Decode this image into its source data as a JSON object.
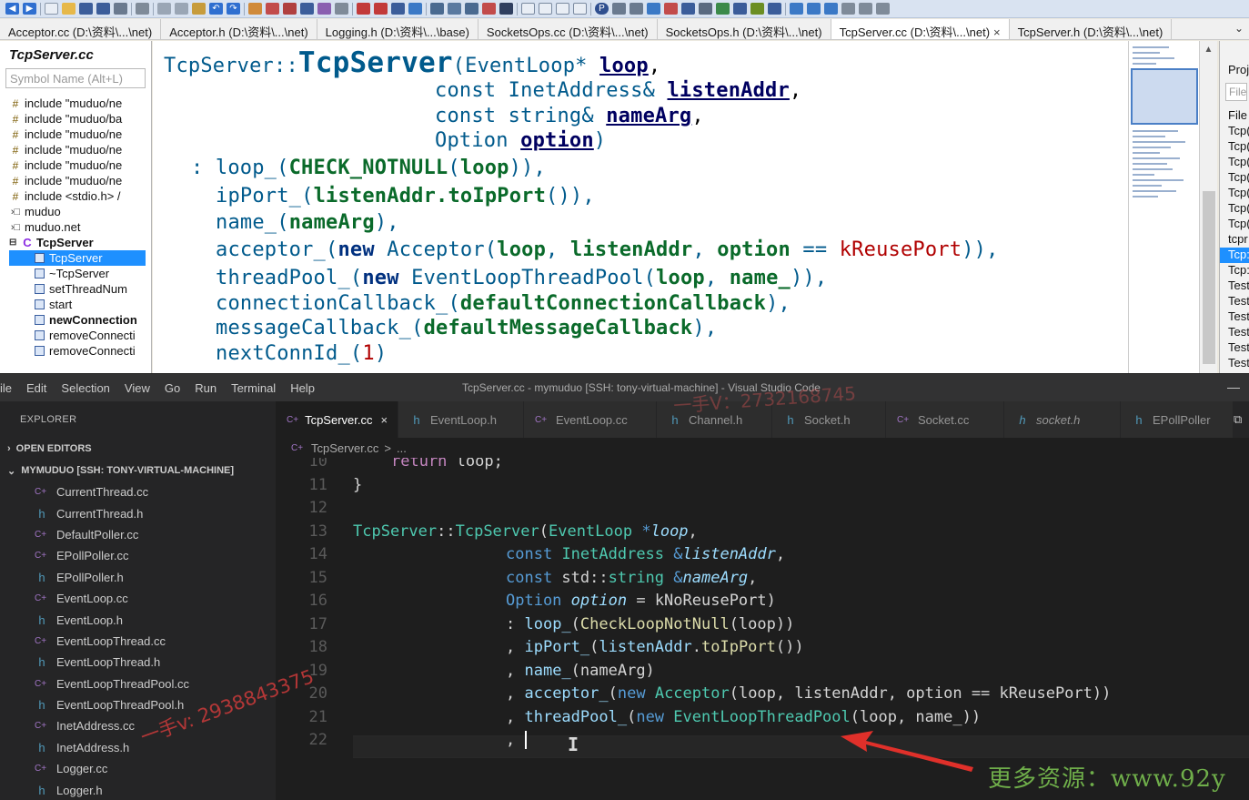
{
  "si": {
    "tabs": [
      {
        "label": "Acceptor.cc (D:\\资料\\...\\net)"
      },
      {
        "label": "Acceptor.h (D:\\资料\\...\\net)"
      },
      {
        "label": "Logging.h (D:\\资料\\...\\base)"
      },
      {
        "label": "SocketsOps.cc (D:\\资料\\...\\net)"
      },
      {
        "label": "SocketsOps.h (D:\\资料\\...\\net)"
      },
      {
        "label": "TcpServer.cc (D:\\资料\\...\\net)",
        "close": "×"
      },
      {
        "label": "TcpServer.h (D:\\资料\\...\\net)"
      }
    ],
    "tabs_more": "⌄",
    "symbol_panel": {
      "title": "TcpServer.cc",
      "search_placeholder": "Symbol Name (Alt+L)",
      "items": [
        {
          "label": "include \"muduo/ne",
          "icon": "include-icon"
        },
        {
          "label": "include \"muduo/ba",
          "icon": "include-icon"
        },
        {
          "label": "include \"muduo/ne",
          "icon": "include-icon"
        },
        {
          "label": "include \"muduo/ne",
          "icon": "include-icon"
        },
        {
          "label": "include \"muduo/ne",
          "icon": "include-icon"
        },
        {
          "label": "include \"muduo/ne",
          "icon": "include-icon"
        },
        {
          "label": "include <stdio.h> /",
          "icon": "include-icon"
        },
        {
          "label": "muduo",
          "icon": "namespace-icon"
        },
        {
          "label": "muduo.net",
          "icon": "namespace-icon"
        },
        {
          "label": "TcpServer",
          "icon": "class-icon"
        },
        {
          "label": "TcpServer",
          "icon": "function-icon"
        },
        {
          "label": "~TcpServer",
          "icon": "function-icon"
        },
        {
          "label": "setThreadNum",
          "icon": "function-icon"
        },
        {
          "label": "start",
          "icon": "function-icon"
        },
        {
          "label": "newConnection",
          "icon": "function-icon"
        },
        {
          "label": "removeConnecti",
          "icon": "function-icon"
        },
        {
          "label": "removeConnecti",
          "icon": "function-icon"
        }
      ]
    },
    "code": {
      "l1": {
        "a": "TcpServer::",
        "b": "TcpServer",
        "c": "(",
        "d": "EventLoop*",
        "e": " ",
        "f": "loop",
        "g": ","
      },
      "l2": {
        "a": "const InetAddress& ",
        "b": "listenAddr",
        "c": ","
      },
      "l3": {
        "a": "const string& ",
        "b": "nameArg",
        "c": ","
      },
      "l4": {
        "a": "Option ",
        "b": "option",
        "c": ")"
      },
      "l5": {
        "a": ": ",
        "b": "loop_",
        "c": "(",
        "d": "CHECK_NOTNULL",
        "e": "(",
        "f": "loop",
        "g": ")),"
      },
      "l6": {
        "a": "ipPort_",
        "b": "(",
        "c": "listenAddr",
        "d": ".",
        "e": "toIpPort",
        "f": "()),"
      },
      "l7": {
        "a": "name_",
        "b": "(",
        "c": "nameArg",
        "d": "),"
      },
      "l8": {
        "a": "acceptor_",
        "b": "(",
        "c": "new",
        "d": " Acceptor(",
        "e": "loop",
        "f": ", ",
        "g": "listenAddr",
        "h": ", ",
        "i": "option",
        "j": " == ",
        "k": "kReusePort",
        "l": ")),"
      },
      "l9": {
        "a": "threadPool_",
        "b": "(",
        "c": "new",
        "d": " EventLoopThreadPool(",
        "e": "loop",
        "f": ", ",
        "g": "name_",
        "h": ")),"
      },
      "l10": {
        "a": "connectionCallback_",
        "b": "(",
        "c": "defaultConnectionCallback",
        "d": "),"
      },
      "l11": {
        "a": "messageCallback_",
        "b": "(",
        "c": "defaultMessageCallback",
        "d": "),"
      },
      "l12": {
        "a": "nextConnId_",
        "b": "(",
        "c": "1",
        "d": ")"
      }
    },
    "project_panel": {
      "title": "Proj",
      "search": "File",
      "header": "File",
      "items": [
        "Tcp(",
        "Tcp(",
        "Tcp(",
        "Tcp(",
        "Tcp(",
        "Tcp(",
        "Tcp(",
        "tcpr",
        "Tcp:",
        "Tcp:",
        "Test",
        "Test",
        "Test",
        "Test",
        "Test",
        "Test"
      ]
    }
  },
  "vscode": {
    "menu": [
      "ile",
      "Edit",
      "Selection",
      "View",
      "Go",
      "Run",
      "Terminal",
      "Help"
    ],
    "title": "TcpServer.cc - mymuduo [SSH: tony-virtual-machine] - Visual Studio Code",
    "window_control": "—",
    "explorer": {
      "title": "EXPLORER",
      "open_editors": "OPEN EDITORS",
      "workspace": "MYMUDUO [SSH: TONY-VIRTUAL-MACHINE]",
      "files": [
        {
          "name": "CurrentThread.cc",
          "kind": "cpp"
        },
        {
          "name": "CurrentThread.h",
          "kind": "h"
        },
        {
          "name": "DefaultPoller.cc",
          "kind": "cpp"
        },
        {
          "name": "EPollPoller.cc",
          "kind": "cpp"
        },
        {
          "name": "EPollPoller.h",
          "kind": "h"
        },
        {
          "name": "EventLoop.cc",
          "kind": "cpp"
        },
        {
          "name": "EventLoop.h",
          "kind": "h"
        },
        {
          "name": "EventLoopThread.cc",
          "kind": "cpp"
        },
        {
          "name": "EventLoopThread.h",
          "kind": "h"
        },
        {
          "name": "EventLoopThreadPool.cc",
          "kind": "cpp"
        },
        {
          "name": "EventLoopThreadPool.h",
          "kind": "h"
        },
        {
          "name": "InetAddress.cc",
          "kind": "cpp"
        },
        {
          "name": "InetAddress.h",
          "kind": "h"
        },
        {
          "name": "Logger.cc",
          "kind": "cpp"
        },
        {
          "name": "Logger.h",
          "kind": "h"
        }
      ]
    },
    "tabs": [
      {
        "label": "TcpServer.cc",
        "kind": "cpp",
        "close": "×"
      },
      {
        "label": "EventLoop.h",
        "kind": "h"
      },
      {
        "label": "EventLoop.cc",
        "kind": "cpp"
      },
      {
        "label": "Channel.h",
        "kind": "h"
      },
      {
        "label": "Socket.h",
        "kind": "h"
      },
      {
        "label": "Socket.cc",
        "kind": "cpp"
      },
      {
        "label": "socket.h",
        "kind": "h"
      },
      {
        "label": "EPollPoller",
        "kind": "h"
      }
    ],
    "breadcrumb": {
      "file": "TcpServer.cc",
      "sep": ">",
      "rest": "..."
    },
    "lines": [
      "10",
      "11",
      "12",
      "13",
      "14",
      "15",
      "16",
      "17",
      "18",
      "19",
      "20",
      "21",
      "22"
    ],
    "code": {
      "l10": {
        "a": "return",
        "b": " loop;"
      },
      "l11": {
        "a": "}"
      },
      "l13": {
        "a": "TcpServer",
        "b": "::",
        "c": "TcpServer",
        "d": "(",
        "e": "EventLoop",
        "f": " *",
        "g": "loop",
        "h": ","
      },
      "l14": {
        "a": "const",
        "b": " ",
        "c": "InetAddress",
        "d": " &",
        "e": "listenAddr",
        "f": ","
      },
      "l15": {
        "a": "const",
        "b": " std::",
        "c": "string",
        "d": " &",
        "e": "nameArg",
        "f": ","
      },
      "l16": {
        "a": "Option",
        "b": " ",
        "c": "option",
        "d": " = ",
        "e": "kNoReusePort",
        "f": ")"
      },
      "l17": {
        "a": ": ",
        "b": "loop_",
        "c": "(",
        "d": "CheckLoopNotNull",
        "e": "(loop))"
      },
      "l18": {
        "a": ", ",
        "b": "ipPort_",
        "c": "(",
        "d": "listenAddr",
        "e": ".",
        "f": "toIpPort",
        "g": "())"
      },
      "l19": {
        "a": ", ",
        "b": "name_",
        "c": "(nameArg)"
      },
      "l20": {
        "a": ", ",
        "b": "acceptor_",
        "c": "(",
        "d": "new",
        "e": " ",
        "f": "Acceptor",
        "g": "(loop, listenAddr, option == kReusePort))"
      },
      "l21": {
        "a": ", ",
        "b": "threadPool_",
        "c": "(",
        "d": "new",
        "e": " ",
        "f": "EventLoopThreadPool",
        "g": "(loop, name_))"
      },
      "l22": {
        "a": ","
      }
    }
  },
  "overlay": {
    "watermark_left": "一手v: 2938843375",
    "watermark_top": "一手V：2732168745",
    "watermark_bottom": "更多资源：www.92y"
  },
  "colors": {
    "annotation_arrow": "#e0302a"
  }
}
